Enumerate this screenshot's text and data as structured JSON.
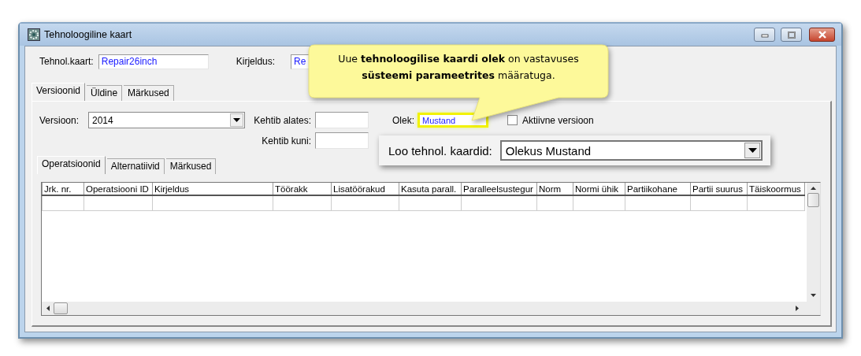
{
  "window": {
    "title": "Tehnoloogiline kaart"
  },
  "header_fields": [
    {
      "label": "Tehnol.kaart:",
      "value": "Repair26inch"
    },
    {
      "label": "Kirjeldus:",
      "value": "Re"
    }
  ],
  "tabs": [
    {
      "label": "Versioonid",
      "selected": true
    },
    {
      "label": "Üldine",
      "selected": false
    },
    {
      "label": "Märkused",
      "selected": false
    }
  ],
  "version_panel": {
    "version": {
      "label": "Versioon:",
      "value": "2014"
    },
    "valid_from": {
      "label": "Kehtib alates:"
    },
    "valid_to": {
      "label": "Kehtib kuni:"
    },
    "status": {
      "label": "Olek:",
      "value": "Mustand",
      "highlighted": true
    },
    "active_version": {
      "label": "Aktiivne versioon",
      "checked": false
    }
  },
  "sub_tabs": [
    {
      "label": "Operatsioonid",
      "selected": true
    },
    {
      "label": "Alternatiivid",
      "selected": false
    },
    {
      "label": "Märkused",
      "selected": false
    }
  ],
  "table": {
    "columns": [
      "Jrk. nr.",
      "Operatsiooni ID",
      "Kirjeldus",
      "Töörakk",
      "Lisatöörakud",
      "Kasuta parall.",
      "Paralleelsustegur",
      "Norm",
      "Normi ühik",
      "Partiikohane",
      "Partii suurus",
      "Täiskoormus"
    ]
  },
  "callouts": [
    {
      "kind": "speech",
      "text": "Uue **tehnoloogilise kaardi olek** on vastavuses **süsteemi parameetrites** määratuga."
    },
    {
      "kind": "setting",
      "label": "Loo tehnol. kaardid:",
      "value": "Olekus Mustand"
    }
  ]
}
